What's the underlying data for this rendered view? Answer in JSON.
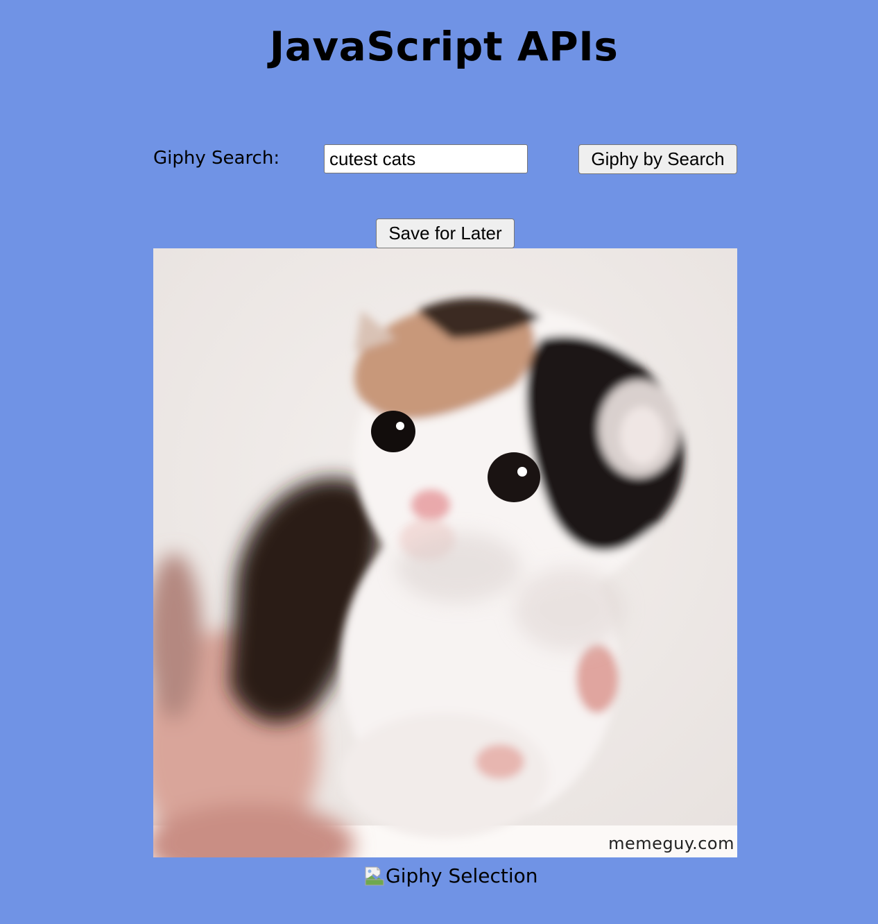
{
  "header": {
    "title": "JavaScript APIs"
  },
  "search": {
    "label": "Giphy Search:",
    "value": "cutest cats",
    "button_label": "Giphy by Search"
  },
  "actions": {
    "save_label": "Save for Later"
  },
  "gif": {
    "watermark": "memeguy.com"
  },
  "broken_image": {
    "alt_text": "Giphy Selection",
    "icon": "broken-image-icon"
  },
  "colors": {
    "background": "#7093e5",
    "button_face": "#efefef"
  }
}
